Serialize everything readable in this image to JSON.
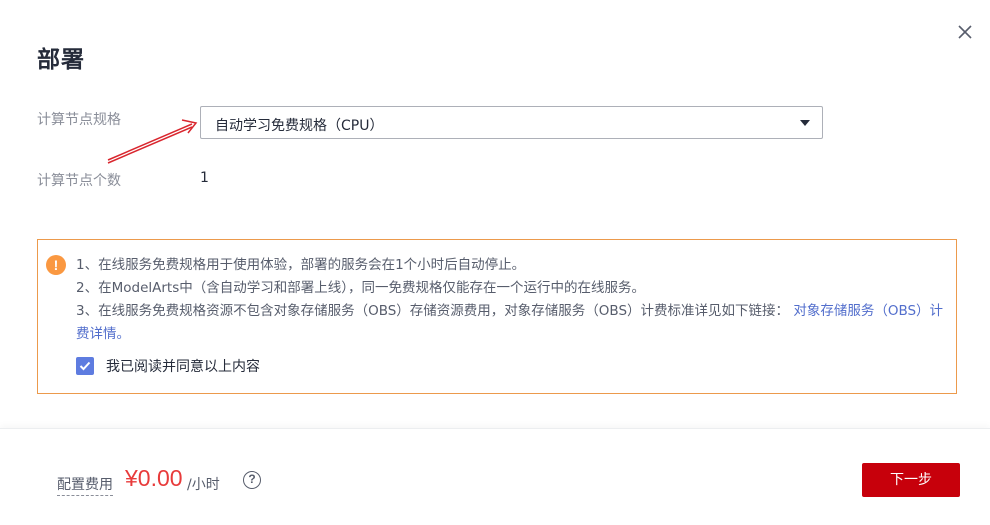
{
  "dialog": {
    "title": "部署",
    "close_icon": "close-icon"
  },
  "form": {
    "spec_label": "计算节点规格",
    "spec_value": "自动学习免费规格（CPU）",
    "count_label": "计算节点个数",
    "count_value": "1"
  },
  "notice": {
    "icon": "warning-icon",
    "line1": "1、在线服务免费规格用于使用体验，部署的服务会在1个小时后自动停止。",
    "line2": "2、在ModelArts中（含自动学习和部署上线），同一免费规格仅能存在一个运行中的在线服务。",
    "line3_text": "3、在线服务免费规格资源不包含对象存储服务（OBS）存储资源费用，对象存储服务（OBS）计费标准详见如下链接：",
    "line3_link": "对象存储服务（OBS）计费详情。",
    "agree_label": "我已阅读并同意以上内容",
    "agree_checked": true
  },
  "footer": {
    "fee_label": "配置费用",
    "fee_amount": "¥0.00",
    "fee_unit": "/小时",
    "help_icon": "?",
    "next_label": "下一步"
  },
  "colors": {
    "primary": "#c7000b",
    "price": "#e83b3b",
    "link": "#526ecc",
    "notice_border": "#ec9a4c",
    "warning": "#fa9841",
    "checkbox": "#5e7ce0",
    "annotation_arrow": "#d9262e"
  }
}
